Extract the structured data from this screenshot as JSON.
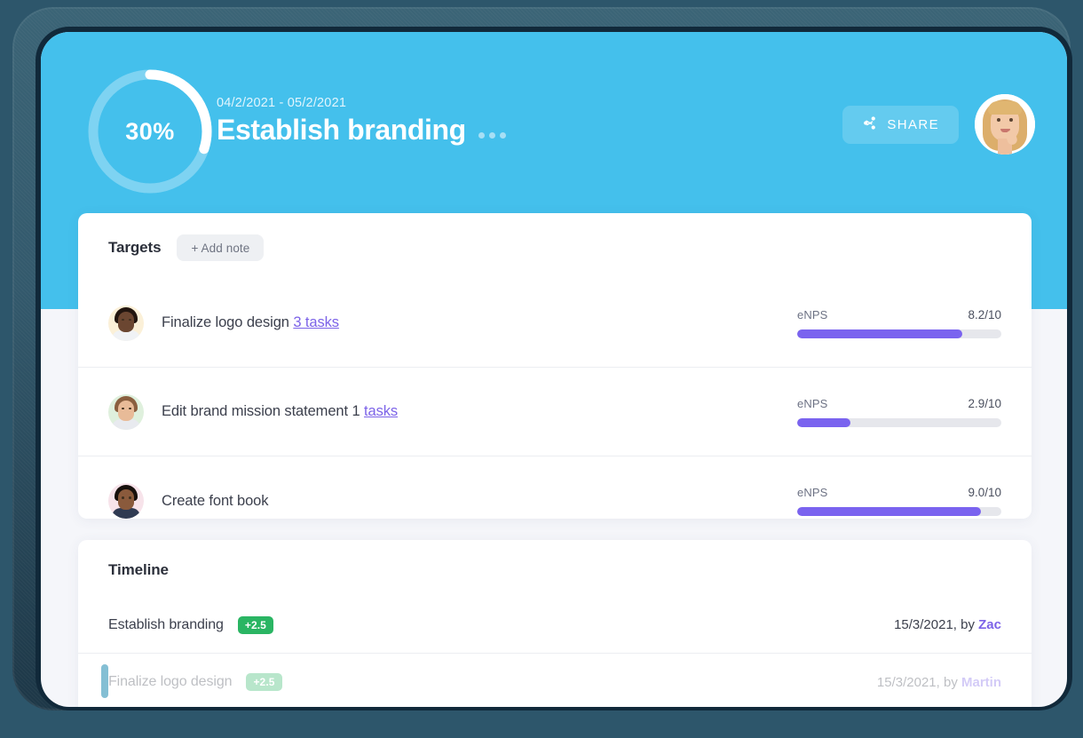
{
  "header": {
    "progress_percent": 30,
    "progress_label": "30%",
    "date_range": "04/2/2021 - 05/2/2021",
    "title": "Establish branding",
    "overflow_menu": "ellipsis-menu",
    "share_label": "SHARE",
    "share_icon": "share-icon",
    "avatar_name": "avatar",
    "bg_color": "#44c0ec",
    "share_bg": "#64cbef"
  },
  "targets": {
    "title": "Targets",
    "add_note_label": "+ Add note",
    "metric_name": "eNPS",
    "rows": [
      {
        "label": "Finalize logo design",
        "tasks_link": "3 tasks",
        "metric_label": "eNPS",
        "metric_value": "8.2/10",
        "metric_percent": 81,
        "avatar_bg": "#fbf0d8",
        "skin": "#6b4631",
        "hair": "#22150f",
        "body": "#f0f2f5"
      },
      {
        "label": "Edit brand mission statement 1",
        "tasks_link": " tasks",
        "metric_label": "eNPS",
        "metric_value": "2.9/10",
        "metric_percent": 26,
        "avatar_bg": "#dff0dd",
        "skin": "#e8bb98",
        "hair": "#8a5f3f",
        "body": "#e8eaef"
      },
      {
        "label": "Create font book",
        "tasks_link": "",
        "metric_label": "eNPS",
        "metric_value": "9.0/10",
        "metric_percent": 90,
        "avatar_bg": "#f7e3ea",
        "skin": "#8a5a3c",
        "hair": "#17100c",
        "body": "#2f3a52"
      }
    ],
    "bar_color": "#7a63ef",
    "bar_track_color": "#e6e7ec"
  },
  "timeline": {
    "title": "Timeline",
    "rows": [
      {
        "name": "Establish branding",
        "delta": "+2.5",
        "date": "15/3/2021, by ",
        "author": "Zac",
        "faded": false
      },
      {
        "name": "Finalize logo design",
        "delta": "+2.5",
        "date": "15/3/2021, by ",
        "author": "Martin",
        "faded": true
      }
    ],
    "chip_color": "#2ab563",
    "author_color": "#7c63e8"
  }
}
